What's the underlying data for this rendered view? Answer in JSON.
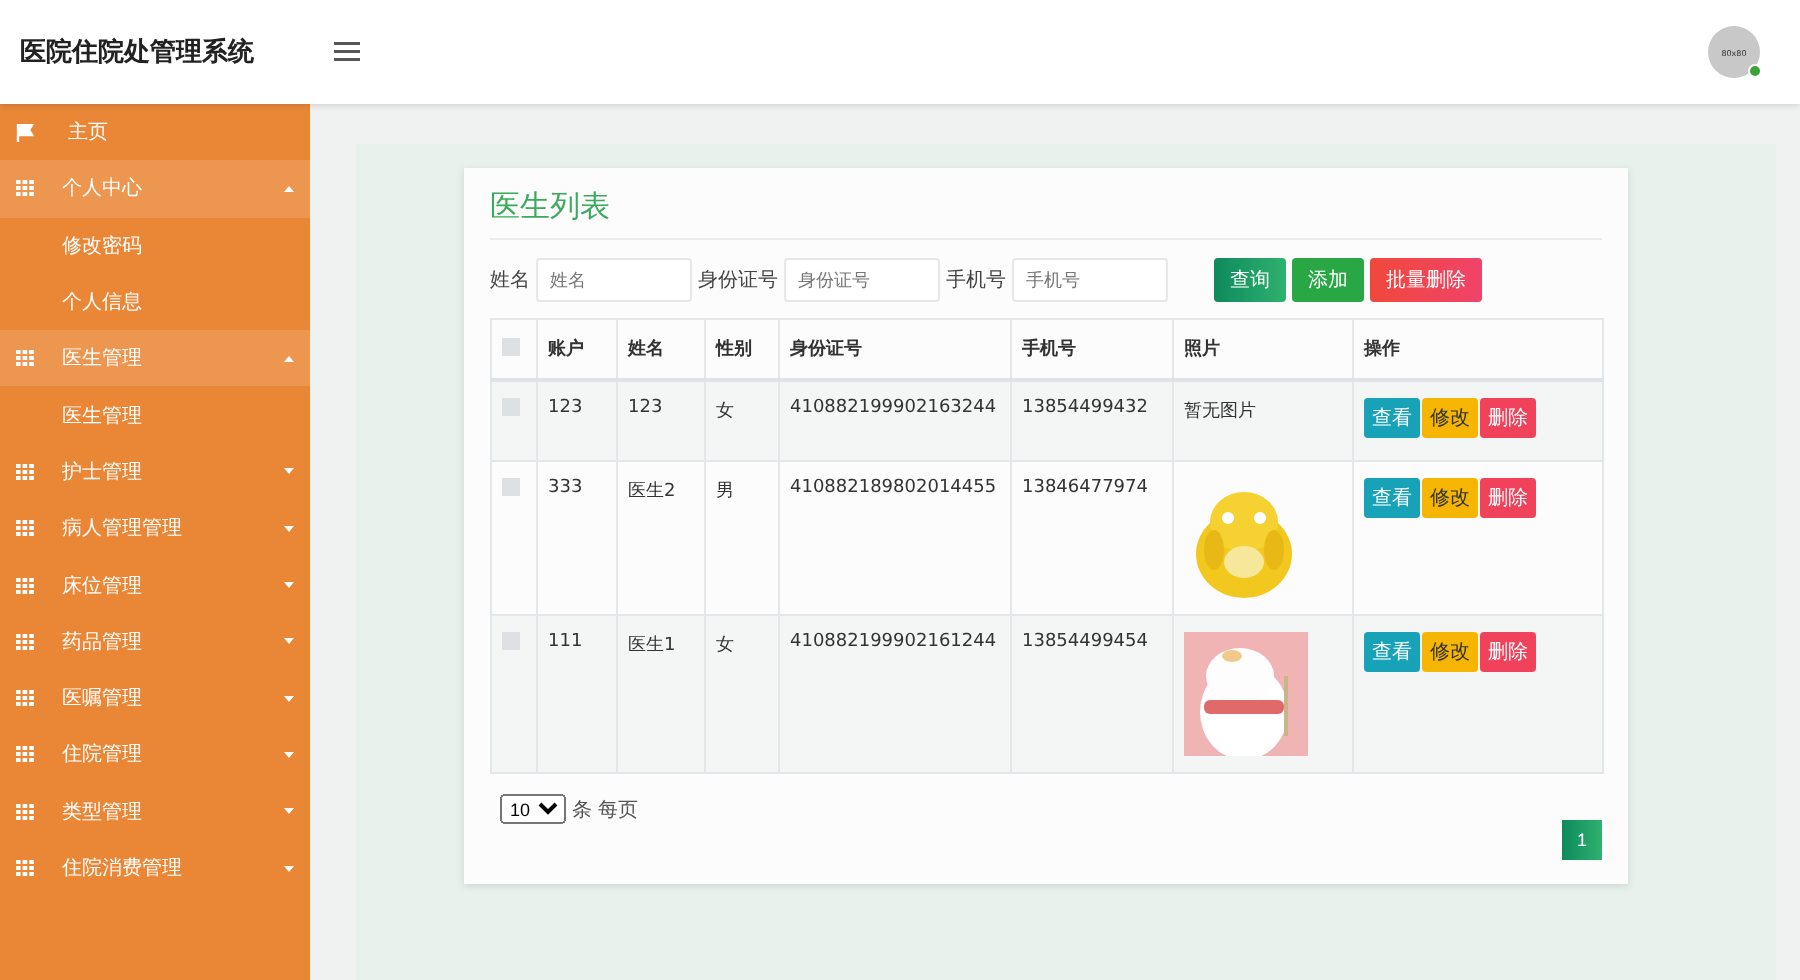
{
  "header": {
    "title": "医院住院处管理系统",
    "avatar_text": "80x80",
    "online": true
  },
  "sidebar": {
    "items": [
      {
        "label": "主页",
        "kind": "link"
      },
      {
        "label": "个人中心",
        "kind": "group",
        "expanded": true,
        "children": [
          {
            "label": "修改密码"
          },
          {
            "label": "个人信息"
          }
        ]
      },
      {
        "label": "医生管理",
        "kind": "group",
        "expanded": true,
        "children": [
          {
            "label": "医生管理"
          }
        ]
      },
      {
        "label": "护士管理",
        "kind": "group",
        "expanded": false
      },
      {
        "label": "病人管理管理",
        "kind": "group",
        "expanded": false
      },
      {
        "label": "床位管理",
        "kind": "group",
        "expanded": false
      },
      {
        "label": "药品管理",
        "kind": "group",
        "expanded": false
      },
      {
        "label": "医嘱管理",
        "kind": "group",
        "expanded": false
      },
      {
        "label": "住院管理",
        "kind": "group",
        "expanded": false
      },
      {
        "label": "类型管理",
        "kind": "group",
        "expanded": false
      },
      {
        "label": "住院消费管理",
        "kind": "group",
        "expanded": false
      }
    ]
  },
  "card": {
    "title": "医生列表",
    "filters": [
      {
        "label": "姓名",
        "placeholder": "姓名"
      },
      {
        "label": "身份证号",
        "placeholder": "身份证号"
      },
      {
        "label": "手机号",
        "placeholder": "手机号"
      }
    ],
    "buttons": [
      {
        "label": "查询",
        "kind": "search"
      },
      {
        "label": "添加",
        "kind": "add"
      },
      {
        "label": "批量删除",
        "kind": "delete"
      }
    ],
    "table": {
      "columns": [
        "账户",
        "姓名",
        "性别",
        "身份证号",
        "手机号",
        "照片",
        "操作"
      ],
      "select_all_checked": false,
      "rows": [
        {
          "checked": false,
          "cells": [
            "123",
            "123",
            "女",
            "410882199902163244",
            "13854499432"
          ],
          "photo": {
            "kind": "text",
            "text": "暂无图片"
          },
          "actions": [
            "查看",
            "修改",
            "删除"
          ]
        },
        {
          "checked": false,
          "cells": [
            "333",
            "医生2",
            "男",
            "410882189802014455",
            "13846477974"
          ],
          "actions": [
            "查看",
            "修改",
            "删除"
          ]
        },
        {
          "checked": false,
          "cells": [
            "111",
            "医生1",
            "女",
            "410882199902161244",
            "13854499454"
          ],
          "actions": [
            "查看",
            "修改",
            "删除"
          ]
        }
      ]
    },
    "page_size": "10",
    "page_size_label": "条 每页",
    "pages": [
      {
        "label": "1",
        "selected": true
      }
    ]
  }
}
